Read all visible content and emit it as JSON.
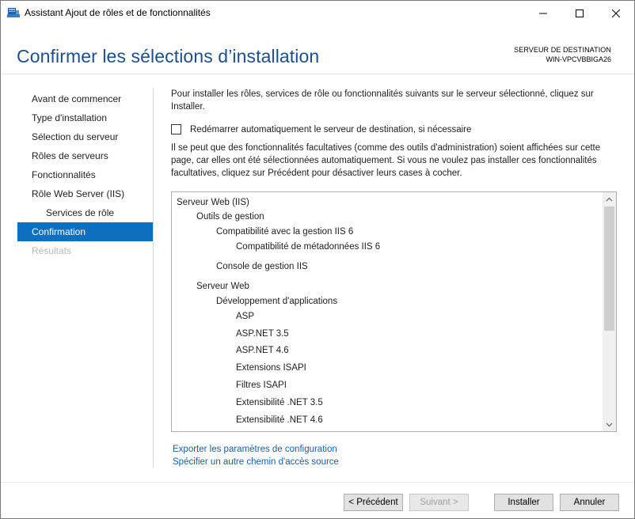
{
  "window": {
    "title": "Assistant Ajout de rôles et de fonctionnalités"
  },
  "header": {
    "page_title": "Confirmer les sélections d’installation",
    "destination_label": "SERVEUR DE DESTINATION",
    "destination_name": "WIN-VPCVBBIGA26"
  },
  "nav": {
    "items": [
      {
        "label": "Avant de commencer",
        "state": "normal"
      },
      {
        "label": "Type d'installation",
        "state": "normal"
      },
      {
        "label": "Sélection du serveur",
        "state": "normal"
      },
      {
        "label": "Rôles de serveurs",
        "state": "normal"
      },
      {
        "label": "Fonctionnalités",
        "state": "normal"
      },
      {
        "label": "Rôle Web Server (IIS)",
        "state": "normal"
      },
      {
        "label": "Services de rôle",
        "state": "sub"
      },
      {
        "label": "Confirmation",
        "state": "active"
      },
      {
        "label": "Résultats",
        "state": "disabled"
      }
    ]
  },
  "content": {
    "intro": "Pour installer les rôles, services de rôle ou fonctionnalités suivants sur le serveur sélectionné, cliquez sur Installer.",
    "restart_label": "Redémarrer automatiquement le serveur de destination, si nécessaire",
    "restart_checked": false,
    "note": "Il se peut que des fonctionnalités facultatives (comme des outils d'administration) soient affichées sur cette page, car elles ont été sélectionnées automatiquement. Si vous ne voulez pas installer ces fonctionnalités facultatives, cliquez sur Précédent pour désactiver leurs cases à cocher.",
    "selections": [
      {
        "label": "Serveur Web (IIS)",
        "level": 0
      },
      {
        "label": "Outils de gestion",
        "level": 1
      },
      {
        "label": "Compatibilité avec la gestion IIS 6",
        "level": 2
      },
      {
        "label": "Compatibilité de métadonnées IIS 6",
        "level": 3
      },
      {
        "label": "Console de gestion IIS",
        "level": 2
      },
      {
        "label": "Serveur Web",
        "level": 1
      },
      {
        "label": "Développement d'applications",
        "level": 2
      },
      {
        "label": "ASP",
        "level": 3
      },
      {
        "label": "ASP.NET 3.5",
        "level": 3
      },
      {
        "label": "ASP.NET 4.6",
        "level": 3
      },
      {
        "label": "Extensions ISAPI",
        "level": 3
      },
      {
        "label": "Filtres ISAPI",
        "level": 3
      },
      {
        "label": "Extensibilité .NET 3.5",
        "level": 3
      },
      {
        "label": "Extensibilité .NET 4.6",
        "level": 3
      }
    ],
    "links": {
      "export": "Exporter les paramètres de configuration",
      "alternate_source": "Spécifier un autre chemin d'accès source"
    }
  },
  "buttons": {
    "previous": "< Précédent",
    "next": "Suivant >",
    "install": "Installer",
    "cancel": "Annuler"
  },
  "colors": {
    "title_blue": "#1e4e8c",
    "nav_active": "#0e6fc0",
    "link": "#1a5ea8"
  }
}
